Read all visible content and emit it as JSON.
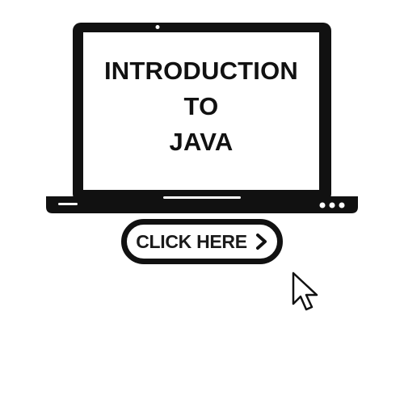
{
  "screen": {
    "line1": "INTRODUCTION",
    "line2": "TO",
    "line3": "JAVA"
  },
  "cta": {
    "label": "CLICK HERE",
    "icon": "chevron-right-icon"
  },
  "icons": {
    "pointer": "mouse-pointer-icon",
    "laptop": "laptop-icon"
  },
  "colors": {
    "ink": "#111111",
    "background": "#ffffff"
  }
}
